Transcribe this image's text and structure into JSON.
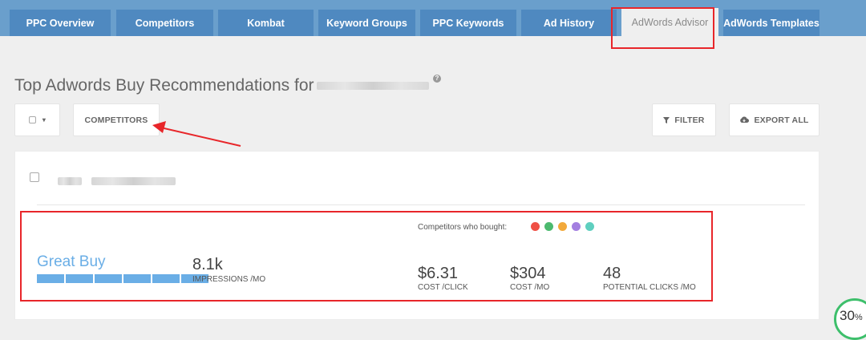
{
  "tabs": [
    {
      "label": "PPC Overview"
    },
    {
      "label": "Competitors"
    },
    {
      "label": "Kombat"
    },
    {
      "label": "Keyword Groups"
    },
    {
      "label": "PPC Keywords"
    },
    {
      "label": "Ad History"
    },
    {
      "label": "AdWords Advisor",
      "active": true
    },
    {
      "label": "AdWords Templates"
    }
  ],
  "page": {
    "title": "Top Adwords Buy Recommendations for",
    "help_icon": "?"
  },
  "toolbar": {
    "select_caret": "▾",
    "competitors_label": "COMPETITORS",
    "filter_label": "FILTER",
    "export_label": "EXPORT ALL"
  },
  "card": {
    "competitors_label": "Competitors who bought:",
    "competitor_colors": [
      "#ef5045",
      "#4cba6f",
      "#f2a93b",
      "#a37fe0",
      "#5fcfbf"
    ],
    "brand_name": "Great Buy",
    "brand_bar_fraction": 1.0,
    "impressions_value": "8.1k",
    "impressions_label": "IMPRESSIONS /MO",
    "cpc_value": "$6.31",
    "cpc_label": "COST /CLICK",
    "cost_value": "$304",
    "cost_label": "COST /MO",
    "clicks_value": "48",
    "clicks_label": "POTENTIAL CLICKS /MO"
  },
  "progress": {
    "value": "30",
    "unit": "%",
    "accent": "#3dbf6b"
  }
}
